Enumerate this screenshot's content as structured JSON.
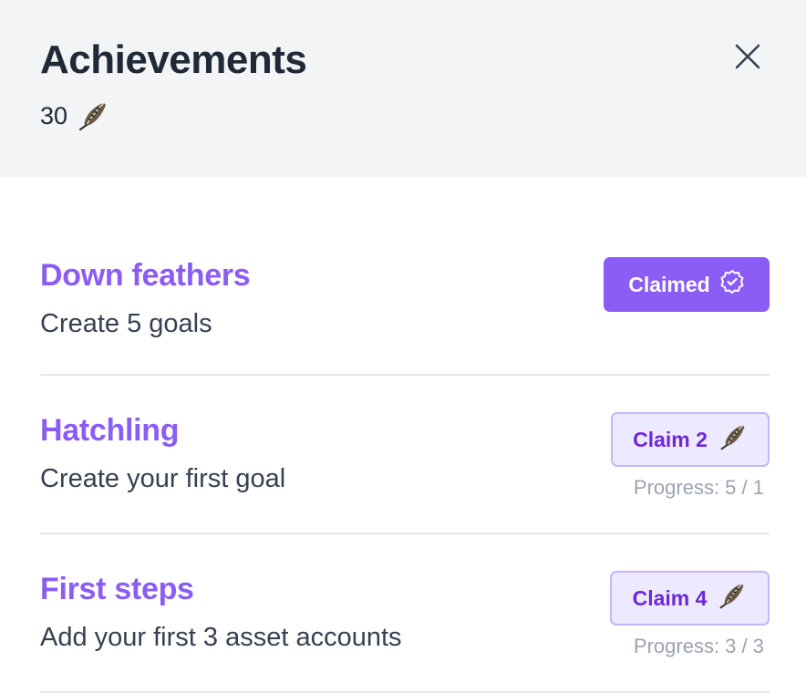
{
  "header": {
    "title": "Achievements",
    "balance": "30",
    "balance_icon": "feather-icon"
  },
  "close": {
    "icon": "close-icon",
    "glyph": "×"
  },
  "achievements": [
    {
      "name": "Down feathers",
      "description": "Create 5 goals",
      "state": "claimed",
      "button_label": "Claimed",
      "button_icon": "check-badge-icon"
    },
    {
      "name": "Hatchling",
      "description": "Create your first goal",
      "state": "claimable",
      "button_label": "Claim 2",
      "button_icon": "feather-icon",
      "progress": "Progress: 5 / 1"
    },
    {
      "name": "First steps",
      "description": "Add your first 3 asset accounts",
      "state": "claimable",
      "button_label": "Claim 4",
      "button_icon": "feather-icon",
      "progress": "Progress: 3 / 3"
    }
  ],
  "colors": {
    "accent": "#8b5cf6",
    "accent_light": "#ede9fe",
    "header_bg": "#f3f4f6",
    "muted": "#9ca3af"
  }
}
